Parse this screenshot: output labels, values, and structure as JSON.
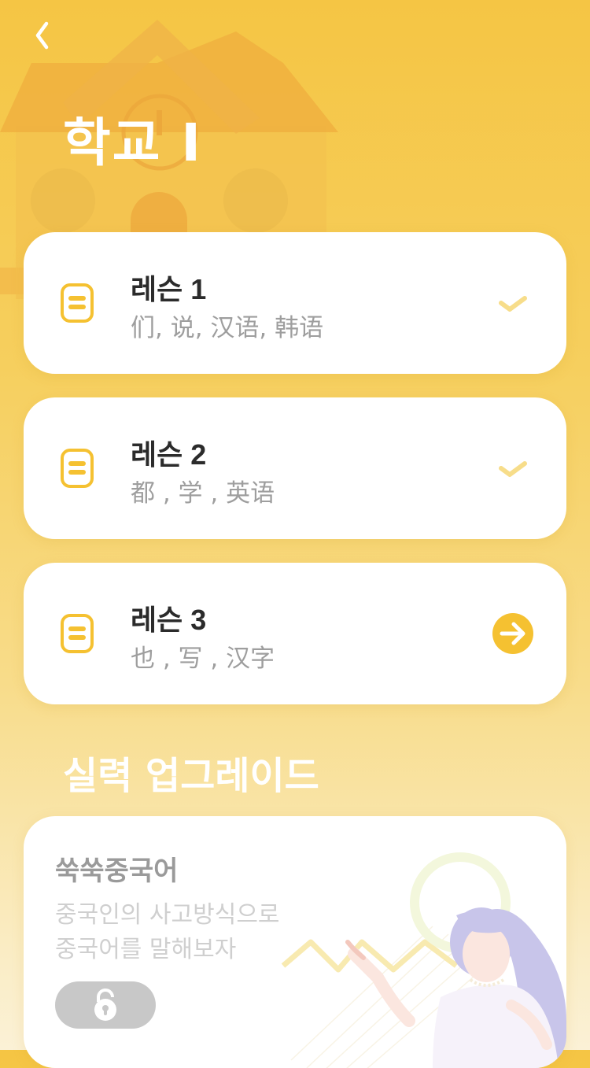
{
  "header": {
    "title": "학교 I"
  },
  "lessons": [
    {
      "title": "레슨 1",
      "subtitle": "们,  说,  汉语,  韩语",
      "status": "completed"
    },
    {
      "title": "레슨 2",
      "subtitle": "都 , 学 , 英语",
      "status": "completed"
    },
    {
      "title": "레슨 3",
      "subtitle": "也 , 写 , 汉字",
      "status": "next"
    }
  ],
  "upgrade": {
    "section_title": "실력 업그레이드",
    "card": {
      "title": "쑥쑥중국어",
      "line1": "중국인의 사고방식으로",
      "line2": "중국어를 말해보자",
      "locked": true
    }
  },
  "colors": {
    "accent": "#f5c131",
    "check": "#f7dd8a",
    "lock_bg": "#c8c8c8"
  },
  "icons": {
    "back": "chevron-left-icon",
    "lesson": "book-icon",
    "done": "check-icon",
    "next": "arrow-right-circle-icon",
    "lock": "lock-icon"
  }
}
